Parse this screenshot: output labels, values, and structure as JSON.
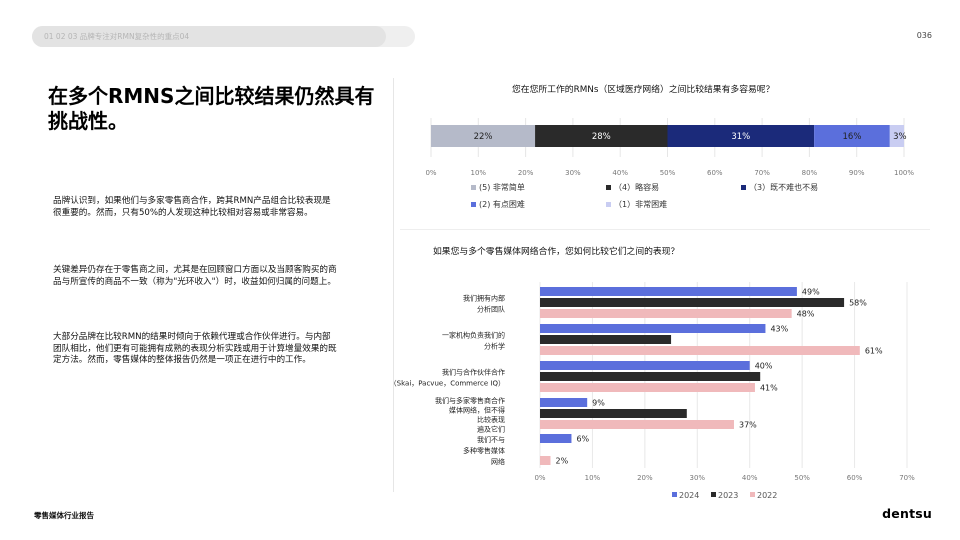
{
  "header": {
    "breadcrumb": "01 02 03 品牌专注对RMN复杂性的重点04",
    "page_number": "036"
  },
  "title": "在多个RMNS之间比较结果仍然具有挑战性。",
  "paragraphs": [
    "品牌认识到，如果他们与多家零售商合作，跨其RMN产品组合比较表现是很重要的。然而，只有50%的人发现这种比较相对容易或非常容易。",
    "关键差异仍存在于零售商之间，尤其是在回顾窗口方面以及当顾客购买的商品与所宣传的商品不一致（称为\"光环收入\"）时，收益如何归属的问题上。",
    "大部分品牌在比较RMN的结果时倾向于依赖代理或合作伙伴进行。与内部团队相比，他们更有可能拥有成熟的表现分析实践或用于计算增量效果的既定方法。然而，零售媒体的整体报告仍然是一项正在进行中的工作。"
  ],
  "footer": {
    "report_title": "零售媒体行业报告",
    "brand": "dentsu"
  },
  "colors": {
    "very_easy": "#b5bac9",
    "easy": "#2a2a2a",
    "neutral": "#1b2a7a",
    "difficult": "#5b6fdc",
    "very_difficult": "#c9cdf2",
    "y2024": "#5b6fdc",
    "y2023": "#2a2a2a",
    "y2022": "#f0b9bb"
  },
  "chart_data": [
    {
      "type": "bar",
      "orientation": "horizontal-stacked",
      "title": "您在您所工作的RMNs（区域医疗网络）之间比较结果有多容易呢？",
      "series": [
        {
          "name": "(5) 非常简单",
          "value": 22,
          "label": "22%",
          "color": "#b5bac9"
        },
        {
          "name": "（4）略容易",
          "value": 28,
          "label": "28%",
          "color": "#2a2a2a"
        },
        {
          "name": "（3）既不难也不易",
          "value": 31,
          "label": "31%",
          "color": "#1b2a7a"
        },
        {
          "name": "(2) 有点困难",
          "value": 16,
          "label": "16%",
          "color": "#5b6fdc"
        },
        {
          "name": "（1）非常困难",
          "value": 3,
          "label": "3%",
          "color": "#c9cdf2"
        }
      ],
      "x_ticks": [
        "0%",
        "10%",
        "20%",
        "30%",
        "40%",
        "50%",
        "60%",
        "70%",
        "80%",
        "90%",
        "100%"
      ],
      "xlim": [
        0,
        100
      ],
      "grid": true,
      "legend_position": "bottom"
    },
    {
      "type": "bar",
      "orientation": "horizontal",
      "title": "如果您与多个零售媒体网络合作，您如何比较它们之间的表现？",
      "categories": [
        [
          "我们拥有内部",
          "分析团队"
        ],
        [
          "一家机构负责我们的",
          "分析学"
        ],
        [
          "我们与合作伙伴合作",
          "（Skai，Pacvue，Commerce IQ）"
        ],
        [
          "我们与多家零售商合作",
          "媒体网络，但不得",
          "比较表现",
          "遍及它们"
        ],
        [
          "我们不与",
          "多种零售媒体",
          "网络"
        ]
      ],
      "series": [
        {
          "name": "2024",
          "values": [
            49,
            43,
            40,
            9,
            6
          ],
          "labels": [
            "49%",
            "43%",
            "40%",
            "9%",
            "6%"
          ],
          "color": "#5b6fdc"
        },
        {
          "name": "2023",
          "values": [
            58,
            25,
            42,
            28,
            null
          ],
          "labels": [
            "58%",
            "",
            "",
            "",
            ""
          ],
          "color": "#2a2a2a"
        },
        {
          "name": "2022",
          "values": [
            48,
            61,
            41,
            37,
            2
          ],
          "labels": [
            "48%",
            "61%",
            "41%",
            "37%",
            "2%"
          ],
          "color": "#f0b9bb"
        }
      ],
      "x_ticks": [
        "0%",
        "10%",
        "20%",
        "30%",
        "40%",
        "50%",
        "60%",
        "70%"
      ],
      "xlim": [
        0,
        70
      ],
      "grid": true,
      "legend_position": "bottom"
    }
  ]
}
